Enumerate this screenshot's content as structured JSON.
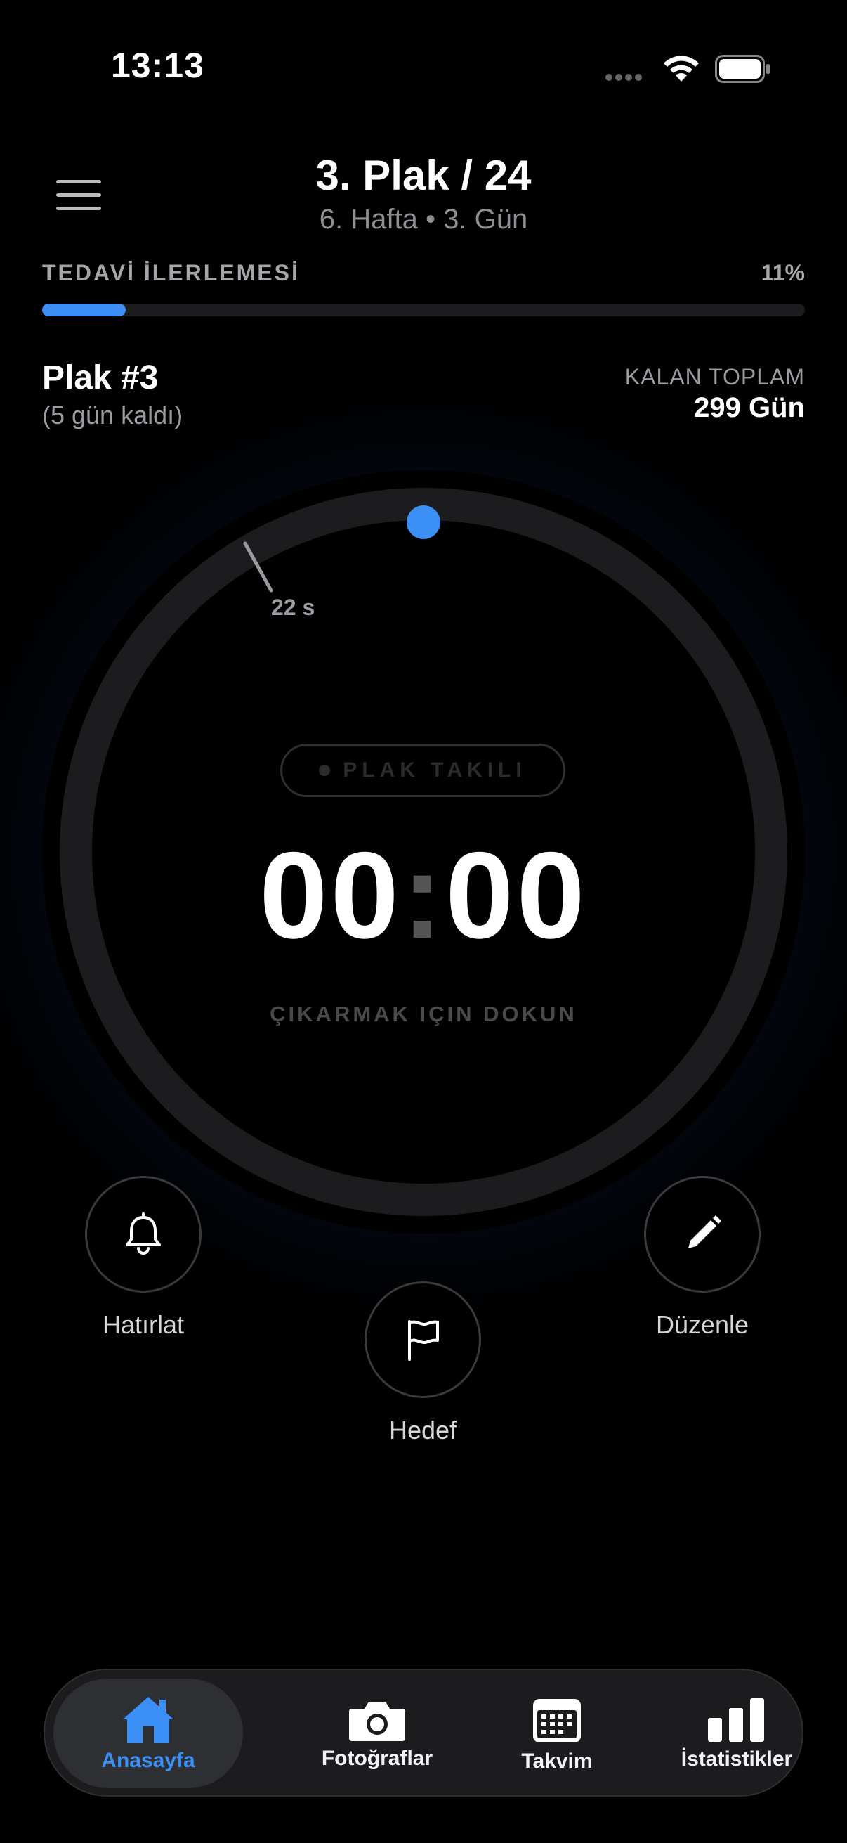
{
  "status_bar": {
    "time": "13:13"
  },
  "header": {
    "title": "3. Plak / 24",
    "subtitle": "6. Hafta • 3. Gün"
  },
  "progress": {
    "label": "TEDAVİ İLERLEMESİ",
    "percent_text": "11%",
    "fraction": 0.11,
    "accent_color": "#3b8ff5"
  },
  "plak_info": {
    "title": "Plak #3",
    "subtitle": "(5 gün kaldı)",
    "remaining_label": "KALAN TOPLAM",
    "remaining_value": "299 Gün"
  },
  "dial": {
    "status_pill": "PLAK TAKILI",
    "timer_minutes": "00",
    "timer_separator": ":",
    "timer_seconds": "00",
    "hint": "ÇIKARMAK IÇIN DOKUN",
    "marker_label": "22 s"
  },
  "actions": [
    {
      "label": "Hatırlat",
      "icon": "bell-icon"
    },
    {
      "label": "Hedef",
      "icon": "flag-icon"
    },
    {
      "label": "Düzenle",
      "icon": "pencil-icon"
    }
  ],
  "tabbar": {
    "tabs": [
      {
        "label": "Anasayfa",
        "icon": "home-icon",
        "active": true
      },
      {
        "label": "Fotoğraflar",
        "icon": "camera-icon",
        "active": false
      },
      {
        "label": "Takvim",
        "icon": "calendar-icon",
        "active": false
      },
      {
        "label": "İstatistikler",
        "icon": "bar-chart-icon",
        "active": false
      }
    ]
  }
}
